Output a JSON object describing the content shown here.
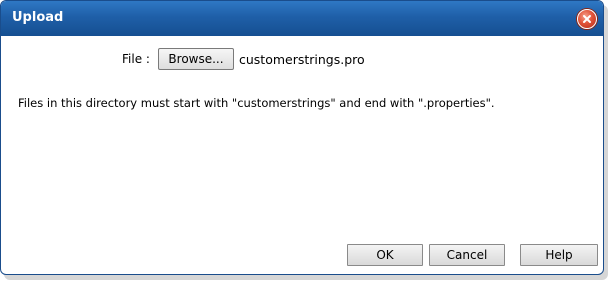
{
  "dialog": {
    "title": "Upload",
    "close_icon": "close-x-icon"
  },
  "form": {
    "file_label": "File :",
    "browse_label": "Browse...",
    "file_name": "customerstrings.pro"
  },
  "info": {
    "text": "Files in this directory must start with \"customerstrings\" and end with \".properties\"."
  },
  "buttons": {
    "ok": "OK",
    "cancel": "Cancel",
    "help": "Help"
  },
  "colors": {
    "titlebar": "#1f5fa8",
    "close_button": "#e1543a"
  }
}
